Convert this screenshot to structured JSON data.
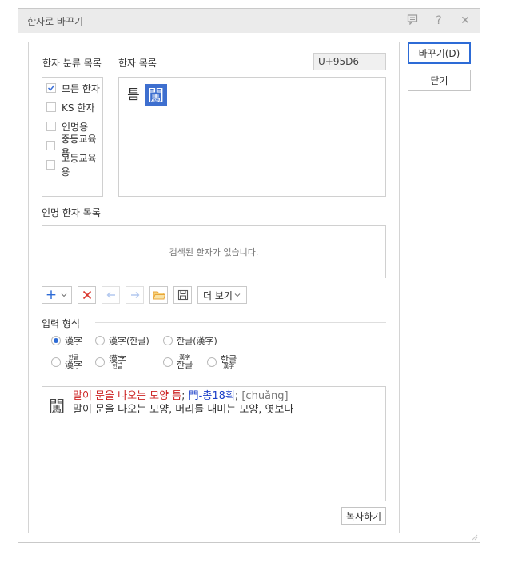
{
  "dialog": {
    "title": "한자로 바꾸기",
    "titlebar_icons": [
      "comment-icon",
      "help-icon",
      "close-icon"
    ],
    "help_glyph": "?",
    "close_glyph": "✕"
  },
  "category": {
    "label": "한자 분류 목록",
    "items": [
      {
        "label": "모든 한자",
        "checked": true
      },
      {
        "label": "KS 한자",
        "checked": false
      },
      {
        "label": "인명용",
        "checked": false
      },
      {
        "label": "중등교육용",
        "checked": false
      },
      {
        "label": "고등교육용",
        "checked": false
      }
    ]
  },
  "hanja_list": {
    "label": "한자 목록",
    "code": "U+95D6",
    "items": [
      "틈",
      "闖"
    ],
    "selected_index": 1
  },
  "name_list": {
    "label": "인명 한자 목록",
    "empty_text": "검색된 한자가 없습니다."
  },
  "toolbar": {
    "add": "+",
    "view_label": "더 보기"
  },
  "input_format": {
    "label": "입력 형식",
    "row1": [
      {
        "label": "漢字",
        "selected": true
      },
      {
        "label": "漢字(한글)",
        "selected": false
      },
      {
        "label": "한글(漢字)",
        "selected": false
      }
    ],
    "row2": [
      {
        "top": "한글",
        "bottom": "漢字"
      },
      {
        "top": "漢字",
        "bottom": "한글"
      },
      {
        "top": "漢字",
        "bottom": "한글"
      },
      {
        "top": "한글",
        "bottom": "漢字"
      }
    ]
  },
  "detail": {
    "hanja": "闖",
    "meaning_red": "말이 문을 나오는 모양 틈",
    "sep1": ";",
    "radical_blue": "門-총18획",
    "sep2": ";",
    "pinyin": "[chuǎng]",
    "line2": "말이 문을 나오는 모양, 머리를 내미는 모양, 엿보다"
  },
  "buttons": {
    "copy": "복사하기",
    "convert": "바꾸기(D)",
    "close": "닫기"
  },
  "colors": {
    "accent": "#2d6bd6",
    "selected_bg": "#3e6fcf",
    "meaning_red": "#cc2222",
    "radical_blue": "#1a3ec8",
    "delete_red": "#d9342b",
    "folder_orange": "#e9a53b"
  }
}
